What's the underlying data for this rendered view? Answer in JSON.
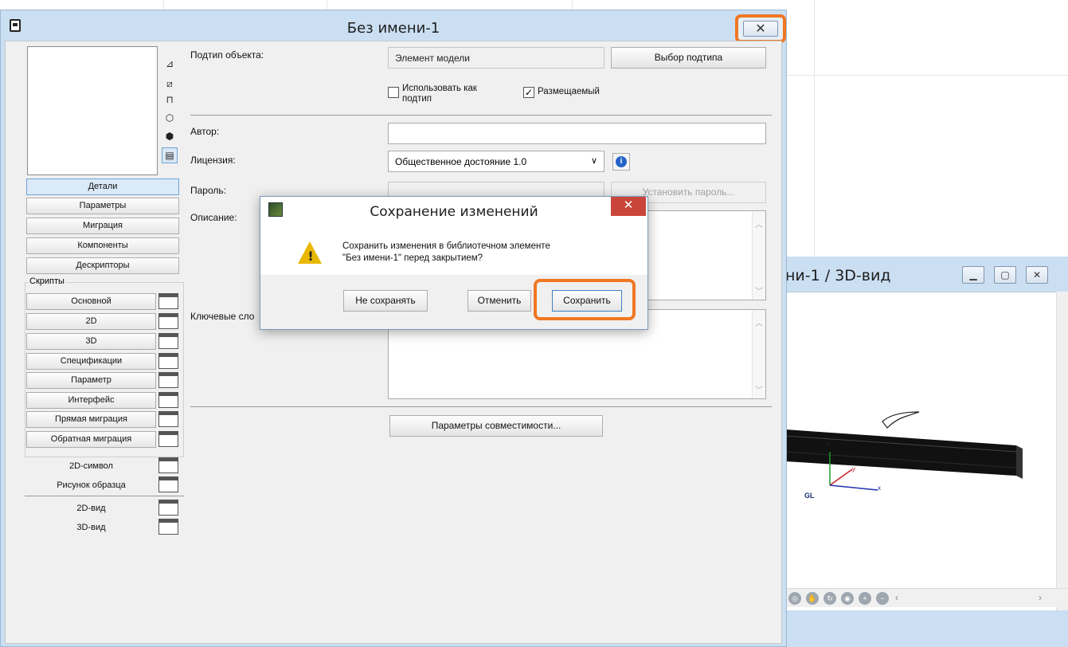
{
  "main_window": {
    "title": "Без имени-1",
    "close_glyph": "✕"
  },
  "left_panel": {
    "toolbar_icons": [
      "plan-view-icon",
      "side-view-icon",
      "front-view-icon",
      "wireframe-icon",
      "shaded-icon",
      "film-icon"
    ],
    "tabs": [
      {
        "label": "Детали",
        "active": true
      },
      {
        "label": "Параметры"
      },
      {
        "label": "Миграция"
      },
      {
        "label": "Компоненты"
      },
      {
        "label": "Дескрипторы"
      }
    ],
    "scripts_header": "Скрипты",
    "scripts": [
      "Основной",
      "2D",
      "3D",
      "Спецификации",
      "Параметр",
      "Интерфейс",
      "Прямая миграция",
      "Обратная миграция"
    ],
    "extras": [
      "2D-символ",
      "Рисунок образца"
    ],
    "views": [
      "2D-вид",
      "3D-вид"
    ]
  },
  "details": {
    "subtype_label": "Подтип объекта:",
    "subtype_value": "Элемент модели",
    "subtype_button": "Выбор подтипа",
    "use_as_subtype_line1": "Использовать как",
    "use_as_subtype_line2": "подтип",
    "use_as_subtype_checked": false,
    "placeable_label": "Размещаемый",
    "placeable_checked": true,
    "author_label": "Автор:",
    "author_value": "",
    "license_label": "Лицензия:",
    "license_value": "Общественное достояние 1.0",
    "password_label": "Пароль:",
    "password_button": "Установить пароль...",
    "description_label": "Описание:",
    "keywords_label": "Ключевые сло",
    "compat_button": "Параметры совместимости..."
  },
  "dialog": {
    "title": "Сохранение изменений",
    "close_glyph": "✕",
    "message_line1": "Сохранить изменения в библиотечном элементе",
    "message_line2": "\"Без имени-1\" перед закрытием?",
    "btn_dont_save": "Не сохранять",
    "btn_cancel": "Отменить",
    "btn_save": "Сохранить",
    "warning_mark": "!"
  },
  "view3d_window": {
    "title": "ни-1 / 3D-вид",
    "axis_z": "z",
    "axis_y": "y",
    "axis_x": "x",
    "gl_label": "GL"
  },
  "colors": {
    "highlight": "#f07724",
    "window_frame": "#cbdff3",
    "dialog_close": "#c9453a"
  }
}
